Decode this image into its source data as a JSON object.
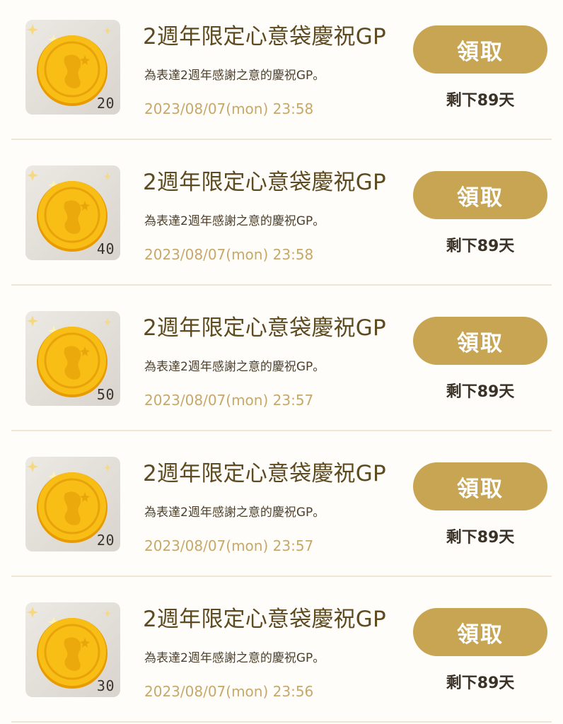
{
  "colors": {
    "button": "#c8a552",
    "title": "#5e4a1f",
    "date": "#c6a86a",
    "divider": "#efe6d6",
    "coin": "#f5b614"
  },
  "items": [
    {
      "icon": "gold-coin-icon",
      "quantity": "20",
      "title": "2週年限定心意袋慶祝GP",
      "description": "為表達2週年感謝之意的慶祝GP。",
      "date": "2023/08/07(mon) 23:58",
      "button_label": "領取",
      "remaining": "剩下89天"
    },
    {
      "icon": "gold-coin-icon",
      "quantity": "40",
      "title": "2週年限定心意袋慶祝GP",
      "description": "為表達2週年感謝之意的慶祝GP。",
      "date": "2023/08/07(mon) 23:58",
      "button_label": "領取",
      "remaining": "剩下89天"
    },
    {
      "icon": "gold-coin-icon",
      "quantity": "50",
      "title": "2週年限定心意袋慶祝GP",
      "description": "為表達2週年感謝之意的慶祝GP。",
      "date": "2023/08/07(mon) 23:57",
      "button_label": "領取",
      "remaining": "剩下89天"
    },
    {
      "icon": "gold-coin-icon",
      "quantity": "20",
      "title": "2週年限定心意袋慶祝GP",
      "description": "為表達2週年感謝之意的慶祝GP。",
      "date": "2023/08/07(mon) 23:57",
      "button_label": "領取",
      "remaining": "剩下89天"
    },
    {
      "icon": "gold-coin-icon",
      "quantity": "30",
      "title": "2週年限定心意袋慶祝GP",
      "description": "為表達2週年感謝之意的慶祝GP。",
      "date": "2023/08/07(mon) 23:56",
      "button_label": "領取",
      "remaining": "剩下89天"
    }
  ]
}
